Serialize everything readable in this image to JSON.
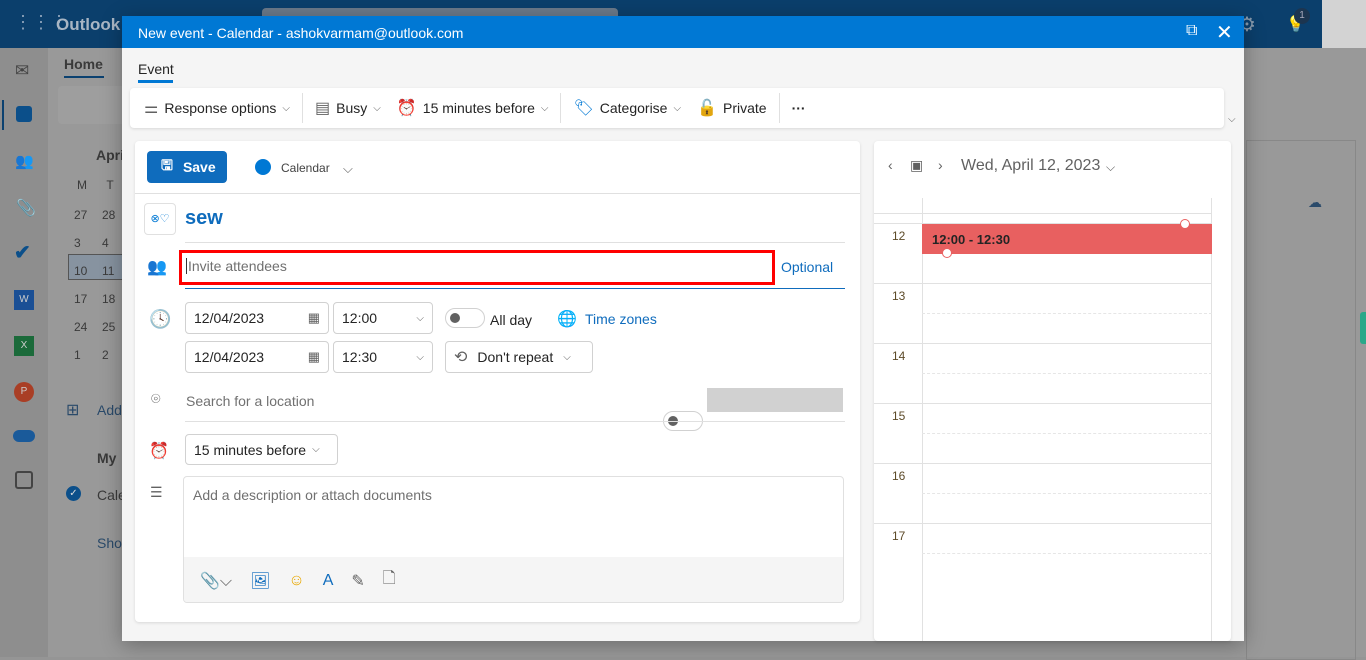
{
  "app": {
    "name": "Outlook",
    "notification_count": "1"
  },
  "background": {
    "home_tab": "Home",
    "month": "April",
    "weekdays": [
      "M",
      "T"
    ],
    "weeks": [
      [
        "27",
        "28"
      ],
      [
        "3",
        "4"
      ],
      [
        "10",
        "11"
      ],
      [
        "17",
        "18"
      ],
      [
        "24",
        "25"
      ],
      [
        "1",
        "2"
      ]
    ],
    "add_calendar": "Add",
    "my_calendars": "My",
    "calendar_item": "Cale",
    "show": "Show"
  },
  "modal": {
    "title": "New event - Calendar - ashokvarmam@outlook.com",
    "tab": "Event",
    "toolbar": {
      "response_options": "Response options",
      "busy": "Busy",
      "reminder": "15 minutes before",
      "categorise": "Categorise",
      "private": "Private",
      "more": "···"
    },
    "form": {
      "save": "Save",
      "calendar": "Calendar",
      "calendar_color": "#0078d4",
      "title": "sew",
      "attendees_placeholder": "Invite attendees",
      "optional": "Optional",
      "start_date": "12/04/2023",
      "start_time": "12:00",
      "all_day": "All day",
      "all_day_on": false,
      "time_zones": "Time zones",
      "end_date": "12/04/2023",
      "end_time": "12:30",
      "repeat": "Don't repeat",
      "location_placeholder": "Search for a location",
      "online_meeting_on": false,
      "reminder": "15 minutes before",
      "description_placeholder": "Add a description or attach documents"
    },
    "calendar": {
      "date": "Wed, April 12, 2023",
      "hours": [
        "12",
        "13",
        "14",
        "15",
        "16",
        "17"
      ],
      "event": {
        "label": "12:00 - 12:30",
        "color": "#e86060"
      }
    }
  },
  "colors": {
    "accent": "#0078d4",
    "highlight": "#ff0000"
  }
}
